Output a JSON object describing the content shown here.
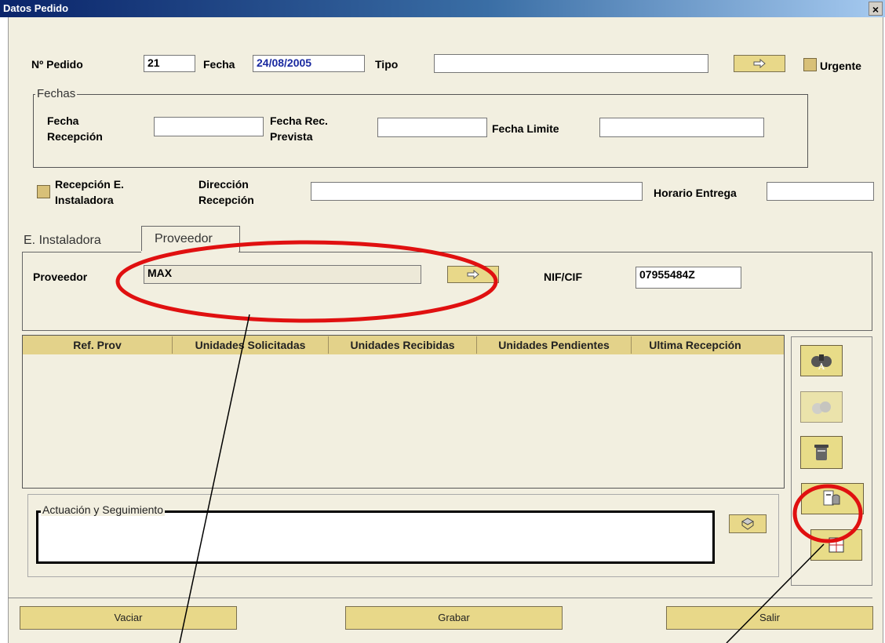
{
  "window": {
    "title": "Datos Pedido",
    "close_glyph": "×"
  },
  "header": {
    "pedido_label": "Nº Pedido",
    "pedido_value": "21",
    "fecha_label": "Fecha",
    "fecha_value": "24/08/2005",
    "tipo_label": "Tipo",
    "tipo_value": "",
    "urgente_label": "Urgente"
  },
  "fechas": {
    "group_title": "Fechas",
    "recepcion_label_1": "Fecha",
    "recepcion_label_2": "Recepción",
    "recepcion_value": "",
    "rec_prevista_label_1": "Fecha Rec.",
    "rec_prevista_label_2": "Prevista",
    "rec_prevista_value": "",
    "limite_label": "Fecha Limite",
    "limite_value": ""
  },
  "entrega": {
    "recepcion_e_label_1": "Recepción E.",
    "recepcion_e_label_2": "Instaladora",
    "direccion_label_1": "Dirección",
    "direccion_label_2": "Recepción",
    "direccion_value": "",
    "horario_label": "Horario Entrega",
    "horario_value": ""
  },
  "tabs": [
    {
      "label": "E. Instaladora",
      "active": false
    },
    {
      "label": "Proveedor",
      "active": true
    }
  ],
  "proveedor": {
    "label": "Proveedor",
    "value": "MAX",
    "nif_label": "NIF/CIF",
    "nif_value": "07955484Z"
  },
  "table": {
    "columns": [
      "Ref. Prov",
      "Unidades Solicitadas",
      "Unidades Recibidas",
      "Unidades Pendientes",
      "Ultima Recepción"
    ],
    "rows": []
  },
  "seguimiento": {
    "group_title": "Actuación y Seguimiento",
    "value": ""
  },
  "side_buttons": [
    "binoculars-icon",
    "binoculars-disabled-icon",
    "trash-icon",
    "hand-document-icon",
    "grid-document-icon"
  ],
  "footer": {
    "vaciar": "Vaciar",
    "grabar": "Grabar",
    "salir": "Salir"
  },
  "colors": {
    "accent_button": "#e8d889",
    "annotation": "#e01010",
    "window_bg": "#f2efe0",
    "title_bar": "#0a246a",
    "date_text": "#1a2aa0"
  }
}
